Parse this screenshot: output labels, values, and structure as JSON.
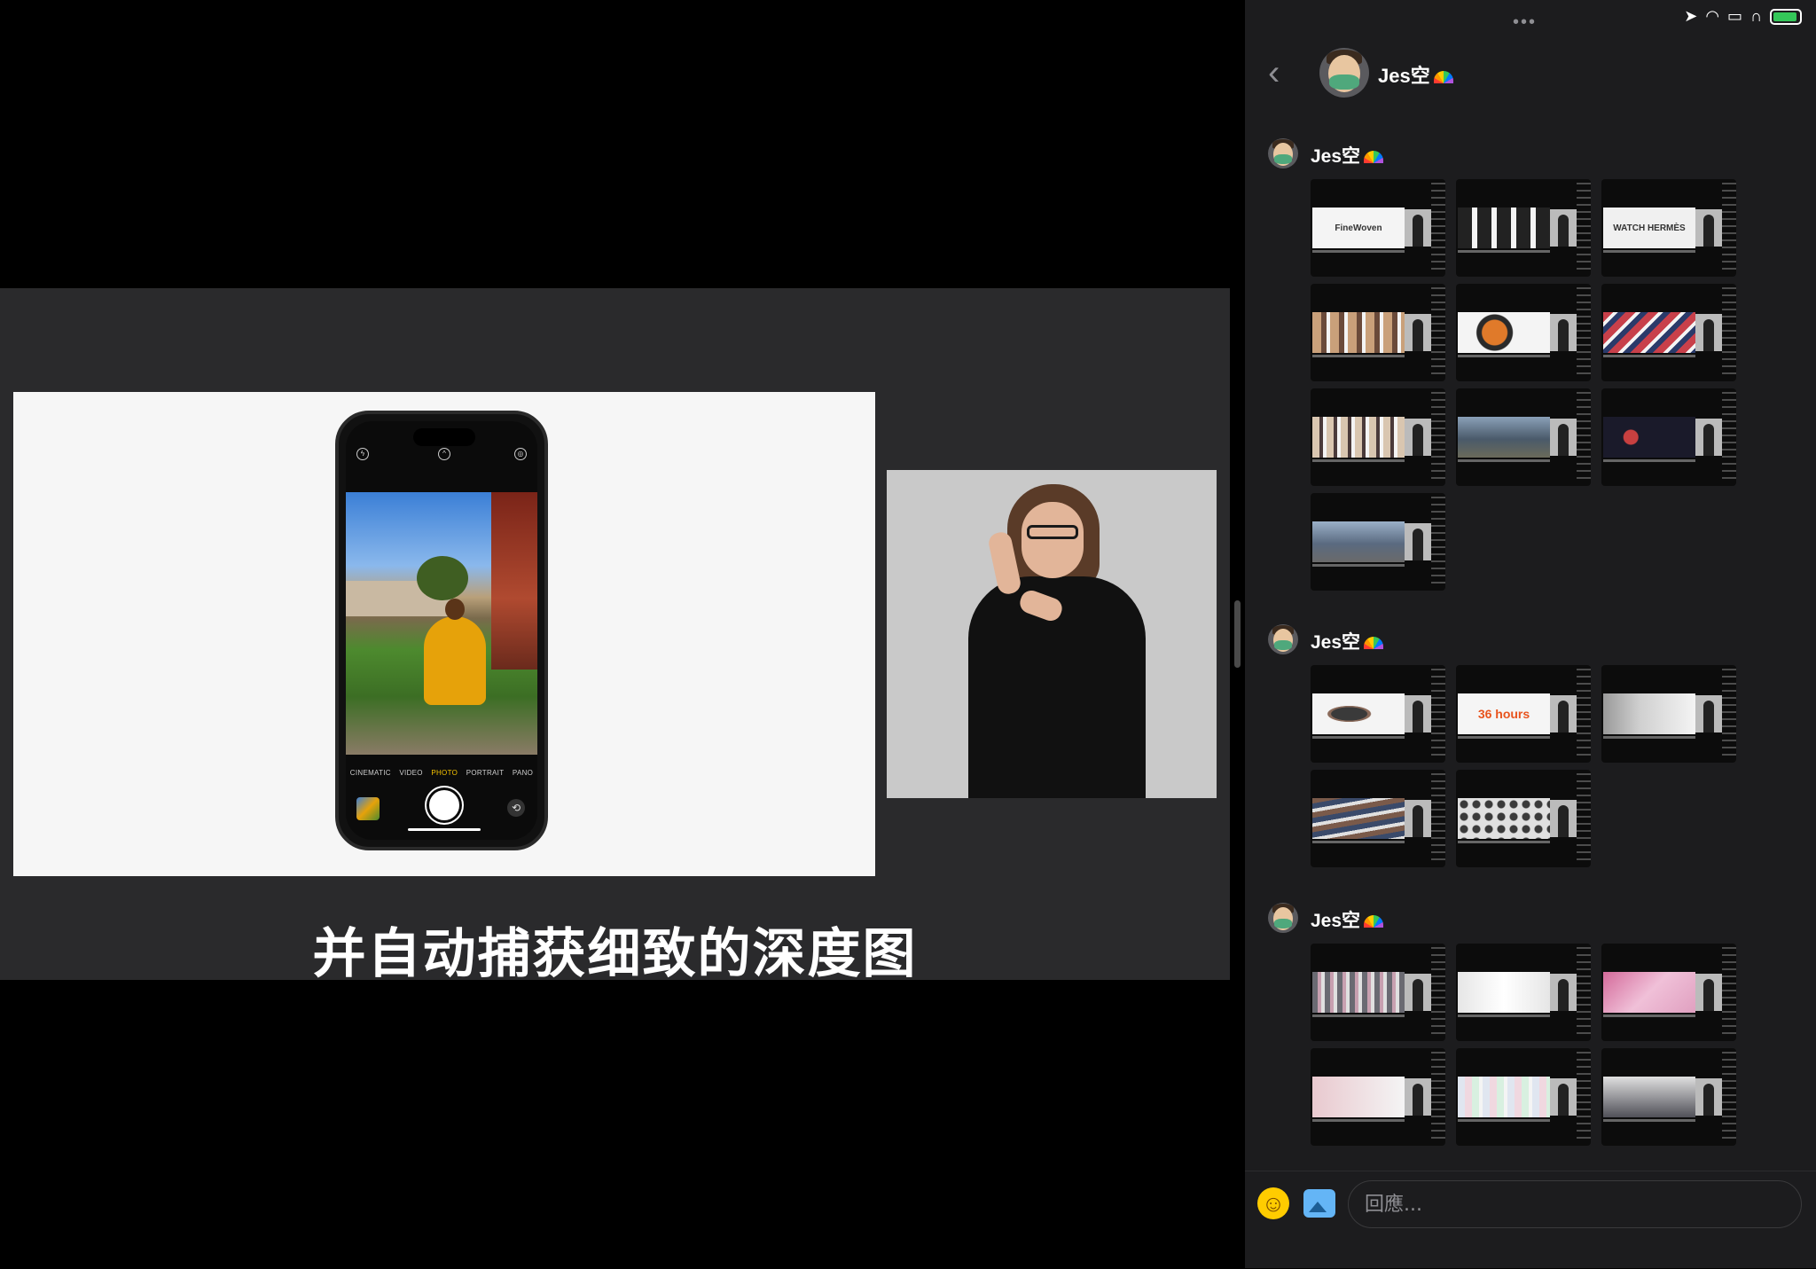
{
  "video": {
    "subtitle": "并自动捕获细致的深度图",
    "camera_modes": [
      "CINEMATIC",
      "VIDEO",
      "PHOTO",
      "PORTRAIT",
      "PANO"
    ],
    "active_mode": "PHOTO"
  },
  "chat": {
    "status_dots": "•••",
    "header": {
      "name": "Jes空"
    },
    "messages": [
      {
        "sender": "Jes空",
        "thumbnails": [
          {
            "text": "FineWoven",
            "art": "#f4f4f4"
          },
          {
            "text": "",
            "art": "#222"
          },
          {
            "text": "WATCH HERMÈS",
            "art": "#f0f0f0"
          },
          {
            "text": "",
            "art": "#c9a07a"
          },
          {
            "text": "",
            "art": "#2a2a2a"
          },
          {
            "text": "",
            "art": "#c8404a"
          },
          {
            "text": "",
            "art": "#d9c6b0"
          },
          {
            "text": "",
            "art": "#4a5a6a"
          },
          {
            "text": "",
            "art": "#1a1a2a"
          },
          {
            "text": "",
            "art": "#5a6a80"
          }
        ]
      },
      {
        "sender": "Jes空",
        "thumbnails": [
          {
            "text": "",
            "art": "#3a3a3a"
          },
          {
            "text": "36 hours",
            "art": "#f5f5f5"
          },
          {
            "text": "",
            "art": "#d0d0d0"
          },
          {
            "text": "",
            "art": "#7a5a4a"
          },
          {
            "text": "",
            "art": "#e0e0e0"
          }
        ]
      },
      {
        "sender": "Jes空",
        "thumbnails": [
          {
            "text": "",
            "art": "#6a6a72"
          },
          {
            "text": "",
            "art": "#e6e6e6"
          },
          {
            "text": "",
            "art": "#d46a9a"
          },
          {
            "text": "",
            "art": "#e9c9cf"
          },
          {
            "text": "",
            "art": "#e0e6f0"
          },
          {
            "text": "",
            "art": "#505058"
          }
        ]
      }
    ],
    "composer": {
      "placeholder": "回應..."
    }
  },
  "colors": {
    "panel_bg": "#1c1c1e",
    "accent_yellow": "#f7c400",
    "battery_green": "#34c759"
  },
  "icons": [
    "back-chevron-icon",
    "location-icon",
    "wifi-icon",
    "car-icon",
    "headphones-icon",
    "battery-icon",
    "emoji-icon",
    "image-icon"
  ]
}
